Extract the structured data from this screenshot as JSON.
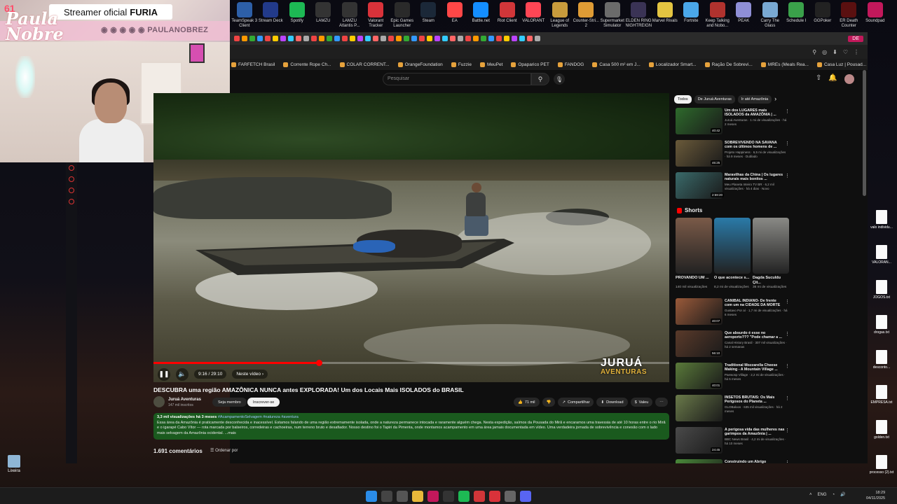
{
  "desktop_apps": [
    {
      "label": "TeamSpeak 3 Client",
      "color": "#2d5fa8"
    },
    {
      "label": "Stream Deck",
      "color": "#223a8a"
    },
    {
      "label": "Spotify",
      "color": "#1db954"
    },
    {
      "label": "LAMZU",
      "color": "#333333"
    },
    {
      "label": "LAMZU Atlantis P...",
      "color": "#333333"
    },
    {
      "label": "Valorant Tracker",
      "color": "#d9323a"
    },
    {
      "label": "Epic Games Launcher",
      "color": "#2a2a2a"
    },
    {
      "label": "Steam",
      "color": "#1b2838"
    },
    {
      "label": "EA",
      "color": "#ff4747"
    },
    {
      "label": "Battle.net",
      "color": "#148eff"
    },
    {
      "label": "Riot Client",
      "color": "#d13639"
    },
    {
      "label": "VALORANT",
      "color": "#ff4655"
    },
    {
      "label": "League of Legends",
      "color": "#c89b3c"
    },
    {
      "label": "Counter-Stri... 2",
      "color": "#de9b35"
    },
    {
      "label": "Supermarket Simulator",
      "color": "#6b6b6b"
    },
    {
      "label": "ELDEN RING NIGHTREIGN",
      "color": "#3a3355"
    },
    {
      "label": "Marvel Rivals",
      "color": "#e3c441"
    },
    {
      "label": "Fortnite",
      "color": "#4aa7e9"
    },
    {
      "label": "Keep Talking and Nobo...",
      "color": "#b0322e"
    },
    {
      "label": "PEAK",
      "color": "#8f8fd6"
    },
    {
      "label": "Carry The Glass",
      "color": "#79a9d3"
    },
    {
      "label": "Schedule I",
      "color": "#3aa14a"
    },
    {
      "label": "GGPoker",
      "color": "#222222"
    },
    {
      "label": "ER Death Counter",
      "color": "#5a1010"
    },
    {
      "label": "Soundpad",
      "color": "#c2185b"
    }
  ],
  "overlay": {
    "badge_prefix": "Streamer oficial",
    "badge_brand": "FURIA",
    "logo_text": "Paula Nobre",
    "social_handle": "PAULANOBREZ",
    "corner_number": "61"
  },
  "browser": {
    "live_tab": "DE",
    "bookmarks": [
      "FARFETCH Brasil",
      "Corrente Rope Ch...",
      "COLAR CORRENT...",
      "OrangeFoundation",
      "Fuzzie",
      "MeuPet",
      "Opaparico PET",
      "FANDOG",
      "Casa 500 m² em J...",
      "Localizador Smart...",
      "Ração De Sobrevi...",
      "MREs (Meals Rea...",
      "Casa Luz | Pousad..."
    ]
  },
  "youtube": {
    "search_placeholder": "Pesquisar",
    "video": {
      "progress_fraction": 0.32,
      "time": "9:16 / 29:10",
      "next_label": "Neste vídeo",
      "watermark": "JURUÁ",
      "watermark_sub": "AVENTURAS"
    },
    "title": "DESCUBRA uma região AMAZÔNICA NUNCA antes EXPLORADA! Um dos Locais Mais ISOLADOS do BRASIL",
    "channel": {
      "name": "Juruá Aventuras",
      "subs": "147 mil inscritos"
    },
    "join_label": "Seja membro",
    "subscribe_label": "Inscrever-se",
    "actions": {
      "likes": "71 mil",
      "share": "Compartilhar",
      "download": "Download",
      "thanks": "Valeu"
    },
    "description": {
      "stats": "3,3 mil visualizações  há 3 meses",
      "tags": "#AcampamentoSelvagem #natureza #aventura",
      "text": "Essa área da Amazônia é praticamente desconhecida e inacessível. Estamos falando de uma região extremamente isolada, onde a natureza permanece intocada e raramente alguém chega. Nesta expedição, saímos da Pousada do Mirã e encaramos uma travessia de até 10 horas entre o rio Mirã e o igarapé Cabo Vítor — rota marcada por balseiros, corredeiras e cachoeiras, num terreno bruto e desafiador. Nosso destino foi o Tapiri da Pimenta, onde montamos acampamento em uma área jamais documentada em vídeo. Uma verdadeira jornada de sobrevivência e conexão com o lado mais selvagem da Amazônia ocidental. ...mais"
    },
    "comments_count": "1.691 comentários",
    "sort_label": "Ordenar por",
    "chips": [
      "Todos",
      "De Juruá Aventuras",
      "Ir até Amazônia"
    ],
    "recs_top": [
      {
        "title": "Um dos LUGARES mais ISOLADOS da AMAZÔNIA | ...",
        "meta": "Juruá Aventuras · 1 mi de visualizações · há 2 meses",
        "dur": "40:42",
        "color": "#2e6a2c"
      },
      {
        "title": "SOBREVIVENDO NA SAVANA com os últimos homens de ...",
        "meta": "Projeto Happiness · 6,5 mi de visualizações · há 9 meses · Dublado",
        "dur": "46:25",
        "color": "#6a5a3a"
      },
      {
        "title": "Maravilhas da China | Os lugares naturais mais bonitos ...",
        "meta": "Meu Planeta Inteiro TV BR · 6,2 mil visualizações · há 4 dias · Novo",
        "dur": "2:59:20",
        "color": "#3a6a6a"
      }
    ],
    "shorts_title": "Shorts",
    "shorts": [
      {
        "title": "PROVANDO UM ...",
        "views": "140 mil visualizações",
        "color": "#7a5a48"
      },
      {
        "title": "O que acontece s...",
        "views": "8,2 mi de visualizações",
        "color": "#2a7aa8"
      },
      {
        "title": "Dagda Suculdu Çit...",
        "views": "36 mi de visualizações",
        "color": "#8a8a86"
      }
    ],
    "recs_bottom": [
      {
        "title": "CANIBAL INDIANO- De frente com um na CIDADE DA MORTE",
        "meta": "Gustavo Por aí · 1,7 mi de visualizações · há 6 meses",
        "dur": "40:07",
        "color": "#9a5a3a"
      },
      {
        "title": "Que absurdo é esse no aeroporto??? \"Pode chamar a ...",
        "meta": "Canal History Brasil · 307 mil visualizações · há 2 semanas",
        "dur": "56:10",
        "color": "#5a3a2a"
      },
      {
        "title": "Traditional Mozzarella Cheese Making - A Mountain Village ...",
        "meta": "Paewosp Village · 2,2 mi de visualizações · há 5 meses",
        "dur": "40:01",
        "color": "#5a7a3a"
      },
      {
        "title": "INSETOS BRUTAIS: Os Mais Perigosos do Planeta ...",
        "meta": "GLOBaloos · 635 mil visualizações · há 2 meses",
        "dur": "",
        "color": "#6a7a4a"
      },
      {
        "title": "A perigosa vida das mulheres nas garimpos da Amazônia | ...",
        "meta": "BBC News Brasil · 4,2 mi de visualizações · há 10 meses",
        "dur": "24:45",
        "color": "#4a4a4a"
      },
      {
        "title": "Construindo um Abrigo",
        "meta": "",
        "dur": "",
        "color": "#4a8a3a"
      }
    ]
  },
  "desktop_files": [
    "valo individu...",
    "VALORAN...",
    "JOGOS.txt",
    "drogas.txt",
    "desconto...",
    "EMPRESA.txt",
    "golden.txt",
    "processo (2).txt"
  ],
  "trash_label": "Lixeira",
  "taskbar": {
    "lang": "ENG",
    "time": "18:29",
    "date": "04/11/2025"
  }
}
